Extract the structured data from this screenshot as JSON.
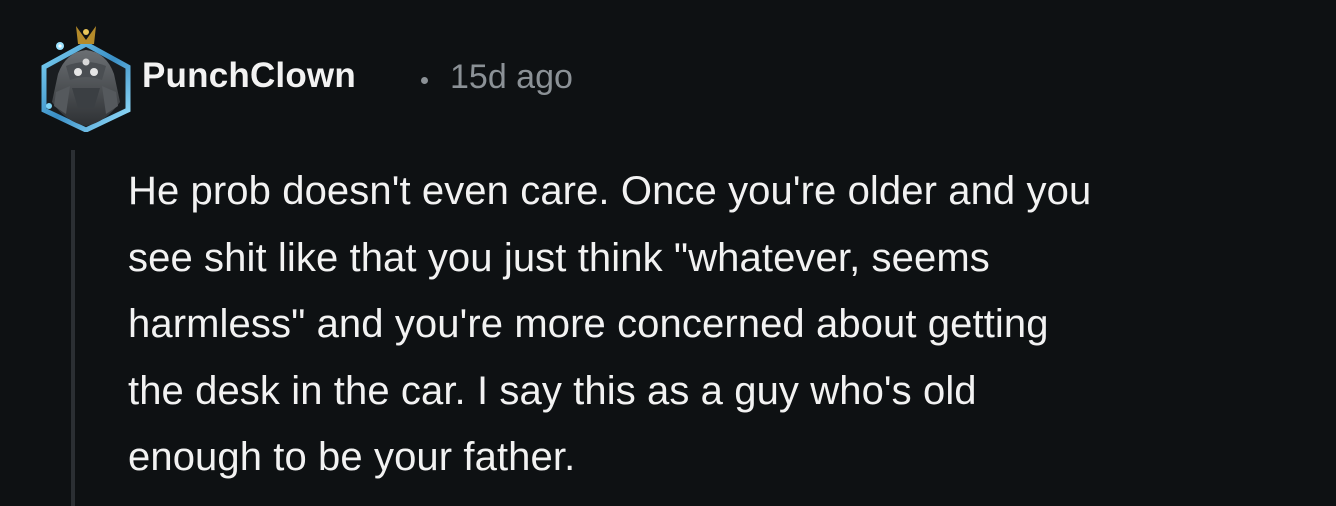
{
  "comment": {
    "author": "PunchClown",
    "separator": "•",
    "timestamp": "15d ago",
    "avatar_icon": "snoo-avatar-icon",
    "body_lines": [
      "He prob doesn't even care. Once you're older and you",
      "see shit like that you just think \"whatever, seems",
      "harmless\" and you're more concerned about getting",
      "the desk in the car. I say this as a guy who's old",
      "enough to be your father."
    ]
  },
  "colors": {
    "background": "#0e1113",
    "text": "#f2f2f2",
    "meta": "#8b9196",
    "thread_line": "#2b2f33",
    "avatar_border": "#4aa6d6"
  }
}
